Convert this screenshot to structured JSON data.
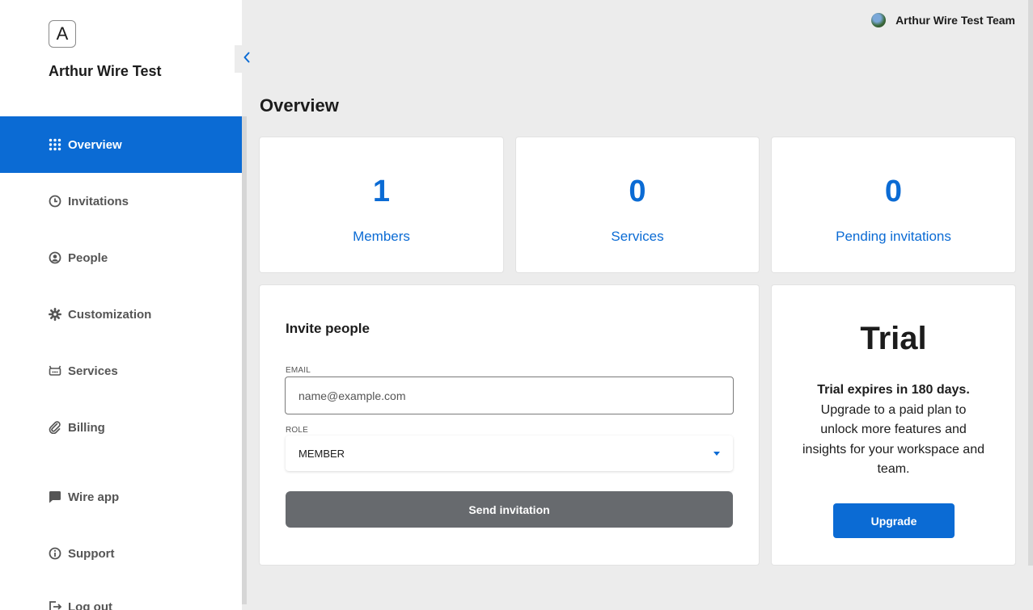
{
  "brand": {
    "logo_letter": "A",
    "name": "Arthur Wire Test"
  },
  "nav": {
    "items": [
      {
        "label": "Overview",
        "icon": "grid-icon",
        "active": true
      },
      {
        "label": "Invitations",
        "icon": "clock-icon"
      },
      {
        "label": "People",
        "icon": "person-icon"
      },
      {
        "label": "Customization",
        "icon": "gear-icon"
      },
      {
        "label": "Services",
        "icon": "robot-icon"
      },
      {
        "label": "Billing",
        "icon": "paperclip-icon"
      },
      {
        "label": "Wire app",
        "icon": "chat-icon"
      },
      {
        "label": "Support",
        "icon": "info-icon"
      },
      {
        "label": "Log out",
        "icon": "logout-icon"
      }
    ]
  },
  "header": {
    "team_name": "Arthur Wire Test Team"
  },
  "page": {
    "title": "Overview"
  },
  "stats": [
    {
      "value": "1",
      "label": "Members"
    },
    {
      "value": "0",
      "label": "Services"
    },
    {
      "value": "0",
      "label": "Pending invitations"
    }
  ],
  "invite": {
    "title": "Invite people",
    "email_label": "EMAIL",
    "email_placeholder": "name@example.com",
    "role_label": "ROLE",
    "role_value": "MEMBER",
    "send_label": "Send invitation"
  },
  "trial": {
    "title": "Trial",
    "bold_text": "Trial expires in 180 days.",
    "text": " Upgrade to a paid plan to unlock more features and insights for your workspace and team.",
    "button_label": "Upgrade"
  },
  "colors": {
    "accent": "#0b6bd4",
    "send_button": "#676a6e",
    "background": "#ececec"
  }
}
